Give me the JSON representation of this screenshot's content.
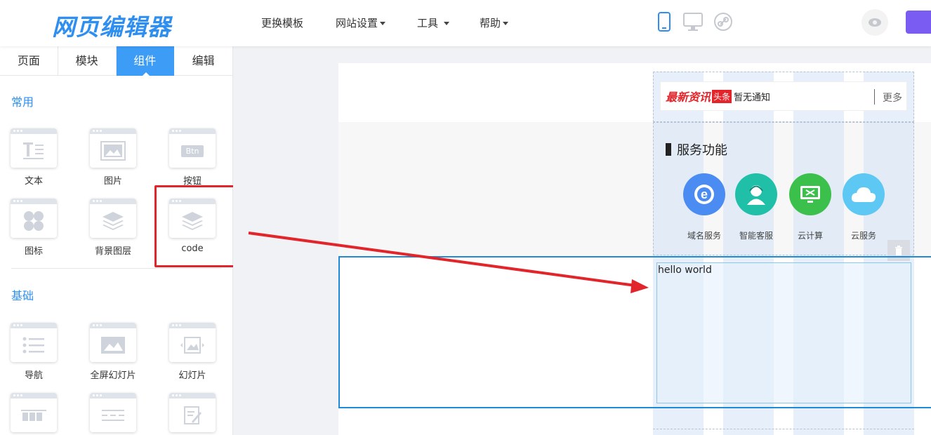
{
  "header": {
    "logo": "网页编辑器",
    "menu": [
      {
        "label": "更换模板",
        "dropdown": false
      },
      {
        "label": "网站设置",
        "dropdown": true
      },
      {
        "label": "工具",
        "dropdown": true
      },
      {
        "label": "帮助",
        "dropdown": true
      }
    ],
    "devices": [
      "mobile-icon",
      "desktop-icon",
      "link-icon"
    ],
    "accent_color": "#7b5cf3"
  },
  "sidebar": {
    "tabs": [
      {
        "label": "页面",
        "active": false
      },
      {
        "label": "模块",
        "active": false
      },
      {
        "label": "组件",
        "active": true
      },
      {
        "label": "编辑",
        "active": false
      }
    ],
    "sections": [
      {
        "title": "常用",
        "items": [
          "文本",
          "图片",
          "按钮",
          "图标",
          "背景图层",
          "code"
        ]
      },
      {
        "title": "基础",
        "items": [
          "导航",
          "全屏幻灯片",
          "幻灯片"
        ]
      }
    ],
    "button_icon_text": "Btn"
  },
  "canvas": {
    "news": {
      "brand_hot": "最新资讯",
      "brand_tou": "头条",
      "text": "暂无通知",
      "more": "更多"
    },
    "services": {
      "title": "服务功能",
      "items": [
        {
          "name": "域名服务",
          "color": "#4a8cf2"
        },
        {
          "name": "智能客服",
          "color": "#20c0a8"
        },
        {
          "name": "云计算",
          "color": "#3cc04c"
        },
        {
          "name": "云服务",
          "color": "#5ec8f4"
        }
      ]
    },
    "code_block": {
      "content": "hello world"
    }
  },
  "annotation_color": "#e2252b"
}
